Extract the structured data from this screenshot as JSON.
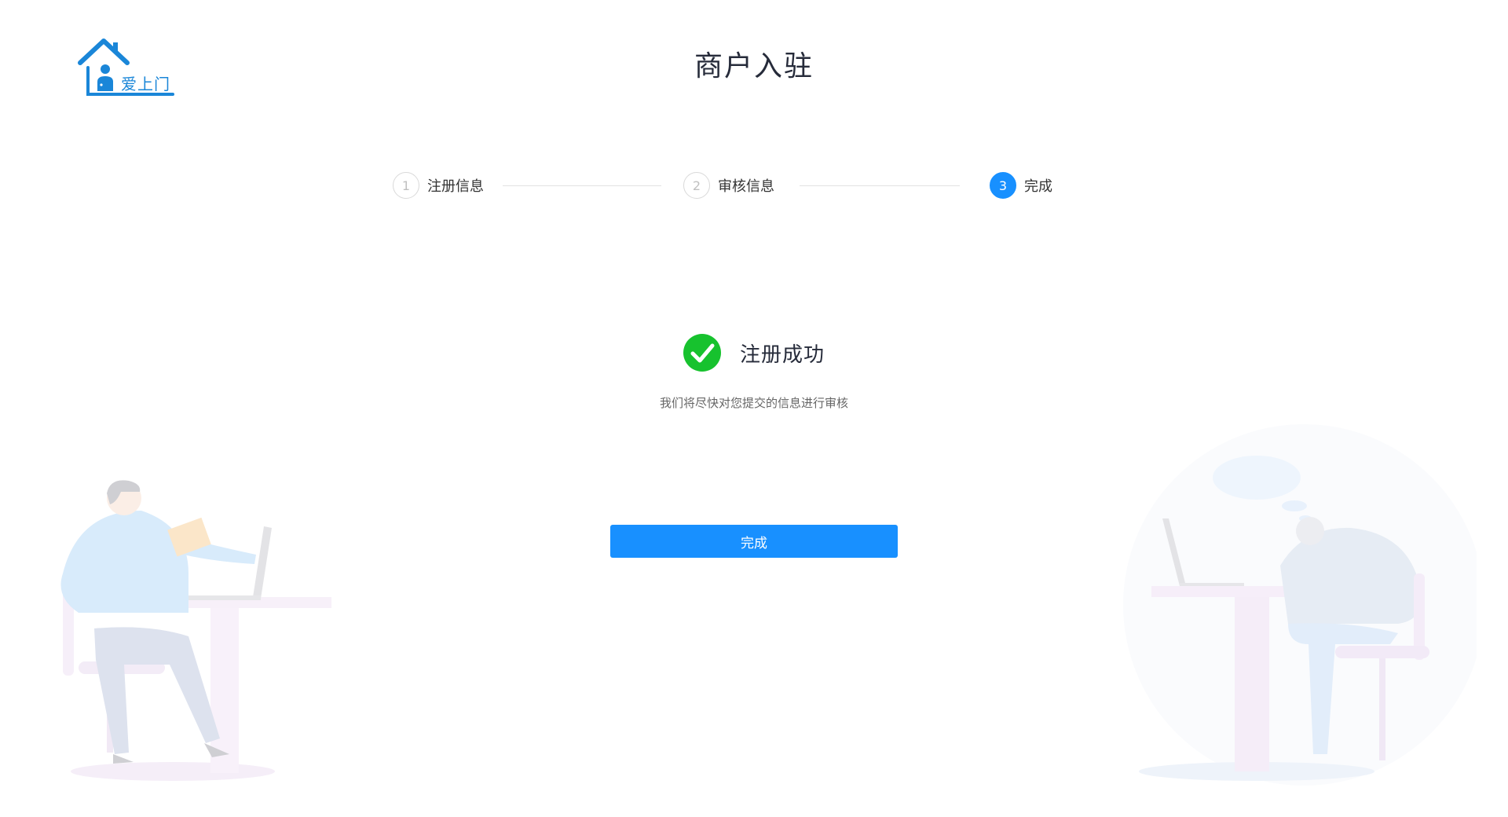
{
  "header": {
    "logo_text": "爱上门",
    "logo_icon": "house-person-icon",
    "title": "商户入驻"
  },
  "steps": [
    {
      "number": "1",
      "label": "注册信息",
      "status": "wait"
    },
    {
      "number": "2",
      "label": "审核信息",
      "status": "wait"
    },
    {
      "number": "3",
      "label": "完成",
      "status": "active"
    }
  ],
  "result": {
    "icon": "check-circle-icon",
    "title": "注册成功",
    "description": "我们将尽快对您提交的信息进行审核"
  },
  "actions": {
    "done_label": "完成"
  },
  "colors": {
    "primary": "#1890ff",
    "success": "#17c22e",
    "logo": "#1a86d8",
    "title": "#262b3a"
  }
}
